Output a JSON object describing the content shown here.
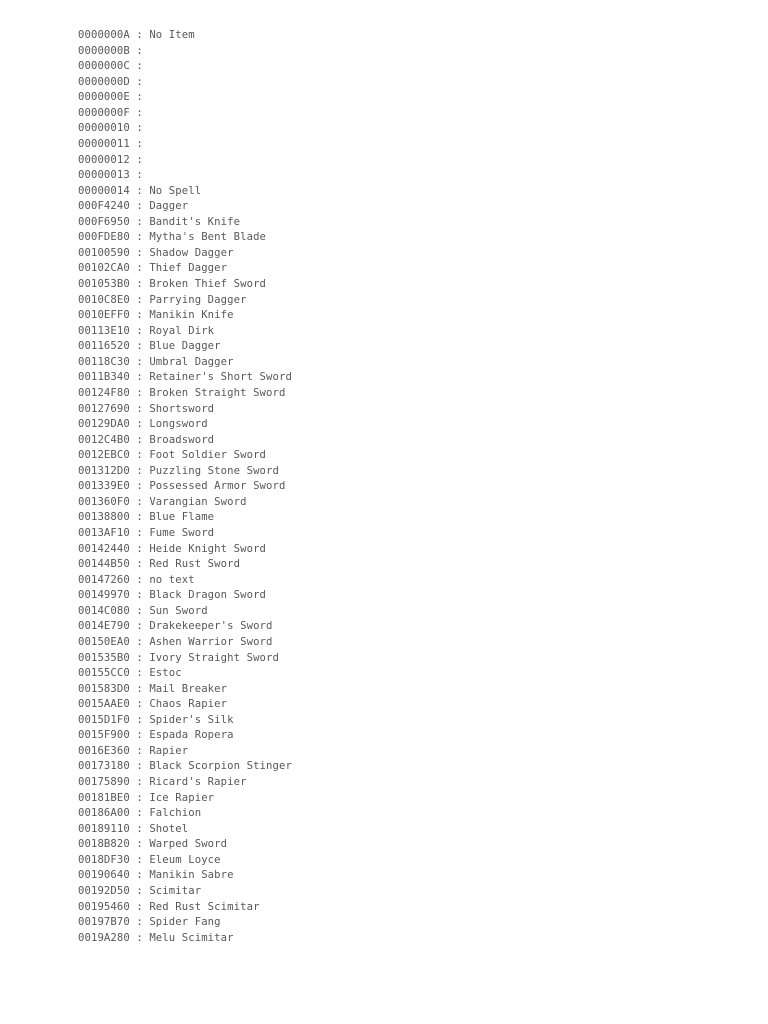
{
  "document": {
    "type": "plain-text-listing",
    "separator": " : ",
    "text_color": "#58585a",
    "background_color": "#ffffff",
    "entries": [
      {
        "id": "0000000A",
        "name": "No Item"
      },
      {
        "id": "0000000B",
        "name": ""
      },
      {
        "id": "0000000C",
        "name": ""
      },
      {
        "id": "0000000D",
        "name": ""
      },
      {
        "id": "0000000E",
        "name": ""
      },
      {
        "id": "0000000F",
        "name": ""
      },
      {
        "id": "00000010",
        "name": ""
      },
      {
        "id": "00000011",
        "name": ""
      },
      {
        "id": "00000012",
        "name": ""
      },
      {
        "id": "00000013",
        "name": ""
      },
      {
        "id": "00000014",
        "name": "No Spell"
      },
      {
        "id": "000F4240",
        "name": "Dagger"
      },
      {
        "id": "000F6950",
        "name": "Bandit's Knife"
      },
      {
        "id": "000FDE80",
        "name": "Mytha's Bent Blade"
      },
      {
        "id": "00100590",
        "name": "Shadow Dagger"
      },
      {
        "id": "00102CA0",
        "name": "Thief Dagger"
      },
      {
        "id": "001053B0",
        "name": "Broken Thief Sword"
      },
      {
        "id": "0010C8E0",
        "name": "Parrying Dagger"
      },
      {
        "id": "0010EFF0",
        "name": "Manikin Knife"
      },
      {
        "id": "00113E10",
        "name": "Royal Dirk"
      },
      {
        "id": "00116520",
        "name": "Blue Dagger"
      },
      {
        "id": "00118C30",
        "name": "Umbral Dagger"
      },
      {
        "id": "0011B340",
        "name": "Retainer's Short Sword"
      },
      {
        "id": "00124F80",
        "name": "Broken Straight Sword"
      },
      {
        "id": "00127690",
        "name": "Shortsword"
      },
      {
        "id": "00129DA0",
        "name": "Longsword"
      },
      {
        "id": "0012C4B0",
        "name": "Broadsword"
      },
      {
        "id": "0012EBC0",
        "name": "Foot Soldier Sword"
      },
      {
        "id": "001312D0",
        "name": "Puzzling Stone Sword"
      },
      {
        "id": "001339E0",
        "name": "Possessed Armor Sword"
      },
      {
        "id": "001360F0",
        "name": "Varangian Sword"
      },
      {
        "id": "00138800",
        "name": "Blue Flame"
      },
      {
        "id": "0013AF10",
        "name": "Fume Sword"
      },
      {
        "id": "00142440",
        "name": "Heide Knight Sword"
      },
      {
        "id": "00144B50",
        "name": "Red Rust Sword"
      },
      {
        "id": "00147260",
        "name": "no text"
      },
      {
        "id": "00149970",
        "name": "Black Dragon Sword"
      },
      {
        "id": "0014C080",
        "name": "Sun Sword"
      },
      {
        "id": "0014E790",
        "name": "Drakekeeper's Sword"
      },
      {
        "id": "00150EA0",
        "name": "Ashen Warrior Sword"
      },
      {
        "id": "001535B0",
        "name": "Ivory Straight Sword"
      },
      {
        "id": "00155CC0",
        "name": "Estoc"
      },
      {
        "id": "001583D0",
        "name": "Mail Breaker"
      },
      {
        "id": "0015AAE0",
        "name": "Chaos Rapier"
      },
      {
        "id": "0015D1F0",
        "name": "Spider's Silk"
      },
      {
        "id": "0015F900",
        "name": "Espada Ropera"
      },
      {
        "id": "0016E360",
        "name": "Rapier"
      },
      {
        "id": "00173180",
        "name": "Black Scorpion Stinger"
      },
      {
        "id": "00175890",
        "name": "Ricard's Rapier"
      },
      {
        "id": "00181BE0",
        "name": "Ice Rapier"
      },
      {
        "id": "00186A00",
        "name": "Falchion"
      },
      {
        "id": "00189110",
        "name": "Shotel"
      },
      {
        "id": "0018B820",
        "name": "Warped Sword"
      },
      {
        "id": "0018DF30",
        "name": "Eleum Loyce"
      },
      {
        "id": "00190640",
        "name": "Manikin Sabre"
      },
      {
        "id": "00192D50",
        "name": "Scimitar"
      },
      {
        "id": "00195460",
        "name": "Red Rust Scimitar"
      },
      {
        "id": "00197B70",
        "name": "Spider Fang"
      },
      {
        "id": "0019A280",
        "name": "Melu Scimitar"
      }
    ]
  }
}
